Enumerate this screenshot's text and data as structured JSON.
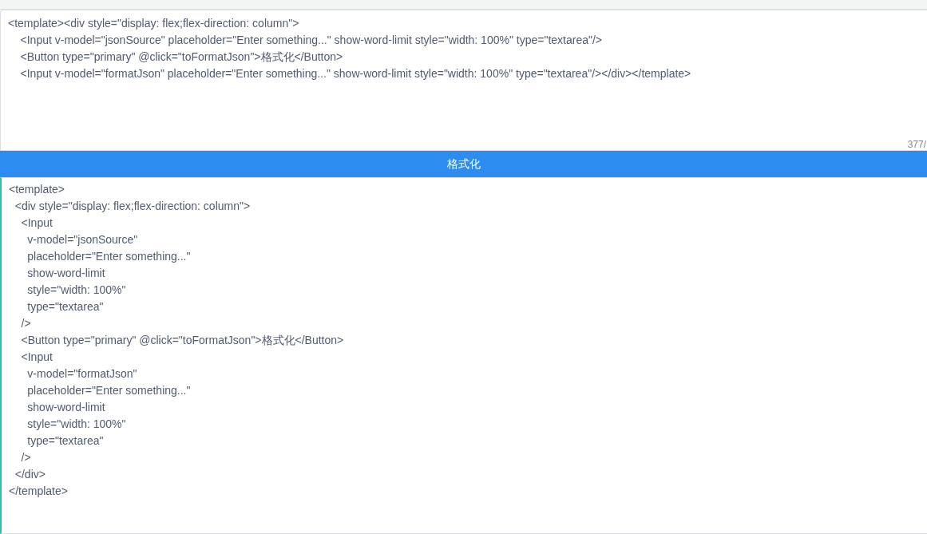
{
  "source_input": {
    "value": "<template><div style=\"display: flex;flex-direction: column\">\n    <Input v-model=\"jsonSource\" placeholder=\"Enter something...\" show-word-limit style=\"width: 100%\" type=\"textarea\"/>\n    <Button type=\"primary\" @click=\"toFormatJson\">格式化</Button>\n    <Input v-model=\"formatJson\" placeholder=\"Enter something...\" show-word-limit style=\"width: 100%\" type=\"textarea\"/></div></template>",
    "word_count": "377/",
    "focused": false
  },
  "format_button": {
    "label": "格式化"
  },
  "output_input": {
    "value": "<template>\n  <div style=\"display: flex;flex-direction: column\">\n    <Input\n      v-model=\"jsonSource\"\n      placeholder=\"Enter something...\"\n      show-word-limit\n      style=\"width: 100%\"\n      type=\"textarea\"\n    />\n    <Button type=\"primary\" @click=\"toFormatJson\">格式化</Button>\n    <Input\n      v-model=\"formatJson\"\n      placeholder=\"Enter something...\"\n      show-word-limit\n      style=\"width: 100%\"\n      type=\"textarea\"\n    />\n  </div>\n</template>",
    "focused": true
  }
}
